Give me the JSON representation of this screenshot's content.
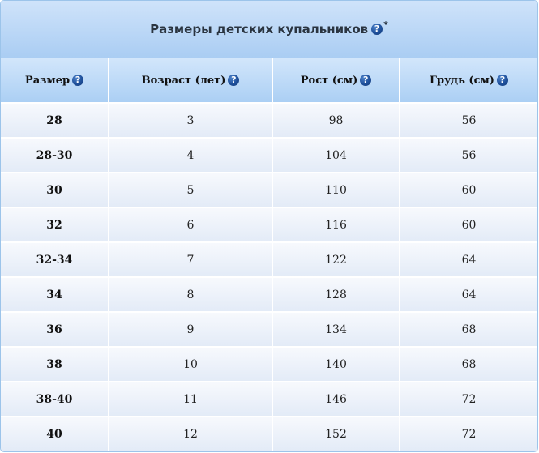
{
  "table": {
    "title": "Размеры детских купальников",
    "title_help_icon": "question-circle-icon",
    "title_suffix": "*",
    "colors": {
      "header_bg": "#aacdf3",
      "cell_bg": "#e9eff9",
      "help_icon": "#1e4f9a"
    },
    "headers": [
      "Размер",
      "Возраст (лет)",
      "Рост (см)",
      "Грудь (см)"
    ],
    "rows": [
      [
        "28",
        "3",
        "98",
        "56"
      ],
      [
        "28-30",
        "4",
        "104",
        "56"
      ],
      [
        "30",
        "5",
        "110",
        "60"
      ],
      [
        "32",
        "6",
        "116",
        "60"
      ],
      [
        "32-34",
        "7",
        "122",
        "64"
      ],
      [
        "34",
        "8",
        "128",
        "64"
      ],
      [
        "36",
        "9",
        "134",
        "68"
      ],
      [
        "38",
        "10",
        "140",
        "68"
      ],
      [
        "38-40",
        "11",
        "146",
        "72"
      ],
      [
        "40",
        "12",
        "152",
        "72"
      ]
    ]
  }
}
